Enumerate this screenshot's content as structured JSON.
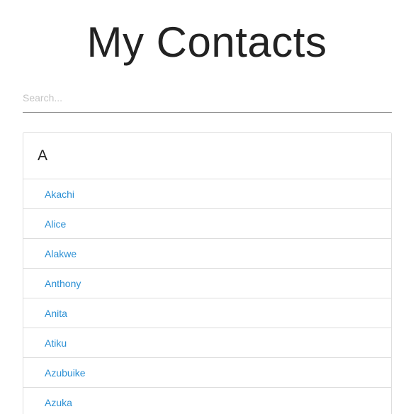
{
  "header": {
    "title": "My Contacts"
  },
  "search": {
    "placeholder": "Search...",
    "value": ""
  },
  "colors": {
    "link": "#2a8fd4",
    "border": "#dddddd",
    "title": "#222222"
  },
  "groups": [
    {
      "letter": "A",
      "contacts": [
        "Akachi",
        "Alice",
        "Alakwe",
        "Anthony",
        "Anita",
        "Atiku",
        "Azubuike",
        "Azuka"
      ]
    }
  ]
}
